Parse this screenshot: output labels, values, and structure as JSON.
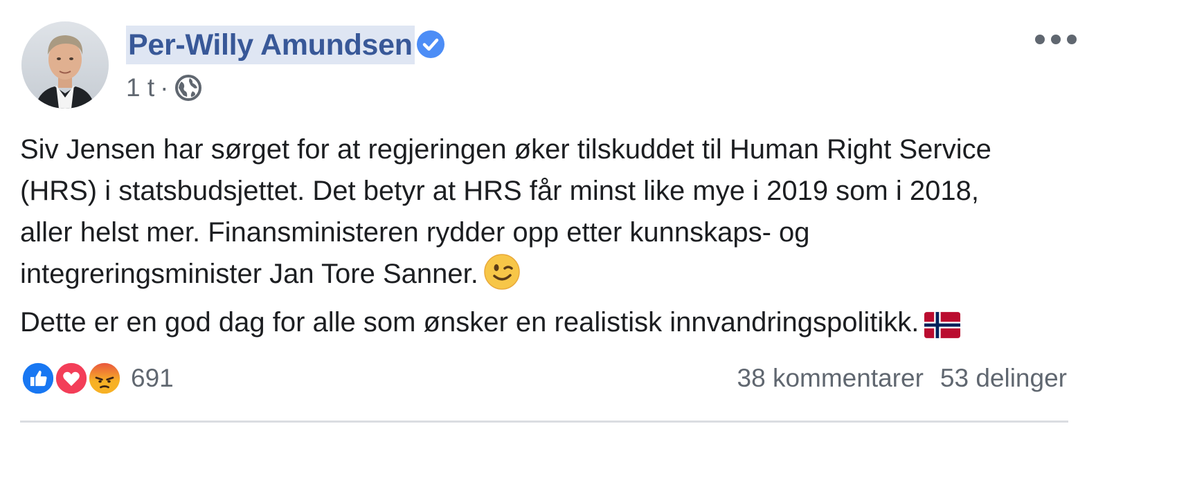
{
  "post": {
    "author": "Per-Willy Amundsen",
    "verified_icon": "verified-badge-icon",
    "timestamp": "1 t",
    "separator": "·",
    "audience_icon": "globe-icon",
    "more_icon": "more-options-icon",
    "text_lines": [
      "Siv Jensen har sørget for at regjeringen øker tilskuddet til Human Right Service",
      "(HRS) i statsbudsjettet. Det betyr at HRS får minst like mye i 2019 som i 2018,",
      "aller helst mer. Finansministeren rydder opp etter kunnskaps- og",
      "integreringsminister Jan Tore Sanner.",
      "Dette er en god dag for alle som ønsker en realistisk innvandringspolitikk."
    ],
    "emojis": [
      "winking-face-icon",
      "norway-flag-icon"
    ],
    "reactions": {
      "icons": [
        "like-icon",
        "love-icon",
        "angry-icon"
      ],
      "count": "691"
    },
    "comments": "38 kommentarer",
    "shares": "53 delinger"
  },
  "colors": {
    "name_blue": "#385898",
    "name_highlight": "#dfe6f3",
    "verified_blue": "#4c8df6",
    "meta_gray": "#606770",
    "text": "#1c1e21",
    "like_blue": "#1877f2",
    "love_red": "#f33e58",
    "angry_orange": "#f7b125"
  }
}
